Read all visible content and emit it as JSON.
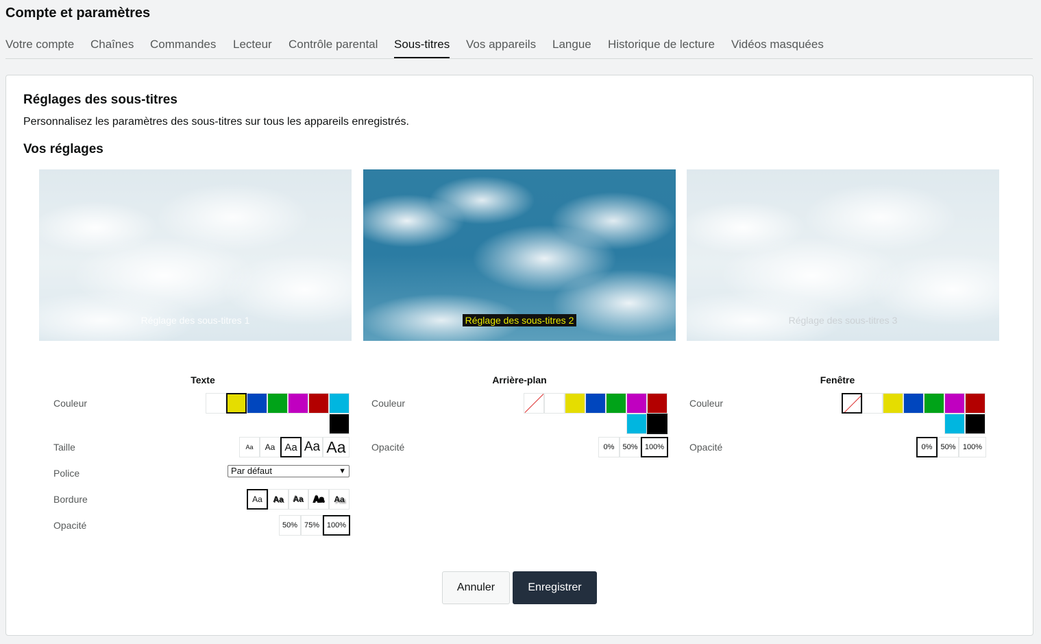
{
  "page_title": "Compte et paramètres",
  "tabs": [
    "Votre compte",
    "Chaînes",
    "Commandes",
    "Lecteur",
    "Contrôle parental",
    "Sous-titres",
    "Vos appareils",
    "Langue",
    "Historique de lecture",
    "Vidéos masquées"
  ],
  "active_tab": "Sous-titres",
  "section": {
    "title": "Réglages des sous-titres",
    "description": "Personnalisez les paramètres des sous-titres sur tous les appareils enregistrés.",
    "subtitle": "Vos réglages"
  },
  "previews": [
    {
      "caption": "Réglage des sous-titres 1"
    },
    {
      "caption": "Réglage des sous-titres 2"
    },
    {
      "caption": "Réglage des sous-titres 3"
    }
  ],
  "text_settings": {
    "title": "Texte",
    "color_label": "Couleur",
    "size_label": "Taille",
    "font_label": "Police",
    "border_label": "Bordure",
    "opacity_label": "Opacité",
    "size_option": "Aa",
    "font_value": "Par défaut",
    "border_option": "Aa",
    "opacity_options": [
      "50%",
      "75%",
      "100%"
    ]
  },
  "background_settings": {
    "title": "Arrière-plan",
    "color_label": "Couleur",
    "opacity_label": "Opacité",
    "opacity_options": [
      "0%",
      "50%",
      "100%"
    ]
  },
  "window_settings": {
    "title": "Fenêtre",
    "color_label": "Couleur",
    "opacity_label": "Opacité",
    "opacity_options": [
      "0%",
      "50%",
      "100%"
    ]
  },
  "colors": {
    "white": "#ffffff",
    "yellow": "#e5dd00",
    "blue": "#0046be",
    "green": "#00a318",
    "magenta": "#c000c0",
    "red": "#b30000",
    "cyan": "#00b6e0",
    "black": "#000000"
  },
  "buttons": {
    "cancel": "Annuler",
    "save": "Enregistrer"
  }
}
